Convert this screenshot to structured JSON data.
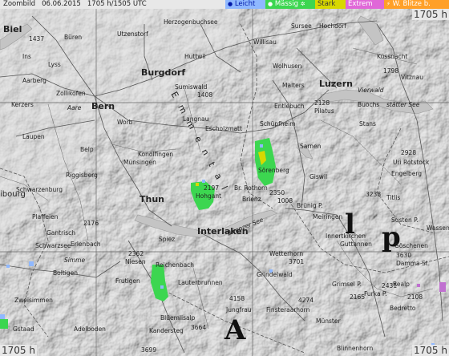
{
  "header": {
    "info": "Zoombild   06.06.2015   1705 h/1505 UTC"
  },
  "legend": [
    {
      "key": "leicht",
      "label": "Leicht",
      "color": "#8fb8ff"
    },
    {
      "key": "massig",
      "label": "Mässig",
      "color": "#3cd650"
    },
    {
      "key": "stark",
      "label": "Stark",
      "color": "#d8d800"
    },
    {
      "key": "extrem",
      "label": "Extrem",
      "color": "#e068d8"
    },
    {
      "key": "blitze",
      "label": "W. Blitze b.",
      "color": "#ffa028"
    }
  ],
  "timestamps": {
    "top_right": "1705 h",
    "bottom_left": "1705 h",
    "bottom_right": "1705 h"
  },
  "places": {
    "biel": "Biel",
    "bueren": "Büren",
    "utzenstorf": "Utzenstorf",
    "herzogenbuchsee": "Herzogenbuchsee",
    "willisau": "Willisau",
    "sursee": "Sursee",
    "hochdorf": "Hochdorf",
    "ins": "Ins",
    "lyss": "Lyss",
    "aarberg": "Aarberg",
    "kerzers": "Kerzers",
    "zollikofen": "Zollikofen",
    "huttwil": "Huttwil",
    "burgdorf": "Burgdorf",
    "sumiswald": "Sumiswald",
    "wolhusen": "Wolhusen",
    "kuessnacht": "Küssnacht",
    "malters": "Malters",
    "luzern": "Luzern",
    "vierwald": "Vierwald",
    "vitznau": "Vitznau",
    "aare": "Aare",
    "bern": "Bern",
    "worb": "Worb",
    "langnau": "Langnau",
    "escholzmatt": "Escholzmatt",
    "entlebuch": "Entlebuch",
    "pilatus": "Pilatus",
    "buochs": "Buochs",
    "staetter_see": "stätter See",
    "laupen": "Laupen",
    "schuepfheim": "Schüpfheim",
    "stans": "Stans",
    "sarnen": "Sarnen",
    "belp": "Belp",
    "konolfingen": "Konolfingen",
    "muensingen": "Münsingen",
    "riggisberg": "Riggisberg",
    "soerenberg": "Sörenberg",
    "uri_rotstock": "Uri Rotstock",
    "engelberg": "Engelberg",
    "schwarzenburg": "Schwarzenburg",
    "fribourg": "ibourg",
    "giswil": "Giswil",
    "hohgant": "Hohgant",
    "br_rothorn": "Br. Rothorn",
    "thun": "Thun",
    "brienz": "Brienz",
    "titlis": "Titlis",
    "plaffeien": "Plaffeien",
    "bruenig": "Brünig P.",
    "meiringen": "Meiringen",
    "susten": "Susten P.",
    "wassen": "Wassen",
    "gantrisch": "Gantrisch",
    "spiez": "Spiez",
    "interlaken": "Interlaken",
    "innertkirchen": "Innertkirchen",
    "schwarzsee": "Schwarzsee",
    "erlenbach": "Erlenbach",
    "brienzer_see": "Brienzer See",
    "guttannen": "Guttannen",
    "goeschenen": "Göschenen",
    "simme": "Simme",
    "niesen": "Niesen",
    "wetterhorn": "Wetterhorn",
    "damma": "Damma St.",
    "boltigen": "Boltigen",
    "reichenbach": "Reichenbach",
    "lauterbrunnen": "Lauterbrunnen",
    "grindelwald": "Grindelwald",
    "grimsel": "Grimsel P.",
    "realp": "Realp",
    "frutigen": "Frutigen",
    "furka": "Furka P.",
    "jungfrau": "Jungfrau",
    "finsteraarhorn": "Finsteraarhorn",
    "zweisimmen": "Zweisimmen",
    "bedretto": "Bedretto",
    "bluemlisalp": "Blüemlisalp",
    "gstaad": "Gstaad",
    "adelboden": "Adelboden",
    "kandersteg": "Kandersteg",
    "muenster": "Münster",
    "blinnenhorn": "Blinnenhorn",
    "emmental": "E m m e n t a l",
    "alpen_a": "A",
    "alpen_l": "l",
    "alpen_p": "p"
  },
  "elevations": [
    "1437",
    "1408",
    "1798",
    "2128",
    "2920",
    "2928",
    "2197",
    "2350",
    "1008",
    "3238",
    "2176",
    "2362",
    "3701",
    "3630",
    "4158",
    "4274",
    "3664",
    "3699",
    "2431",
    "2165",
    "2108"
  ],
  "precipitation_cells": [
    {
      "intensity": "massig",
      "area": "Sörenberg"
    },
    {
      "intensity": "massig",
      "area": "Hohgant"
    },
    {
      "intensity": "massig",
      "area": "Reichenbach"
    },
    {
      "intensity": "leicht",
      "area": "Gstaad"
    }
  ]
}
